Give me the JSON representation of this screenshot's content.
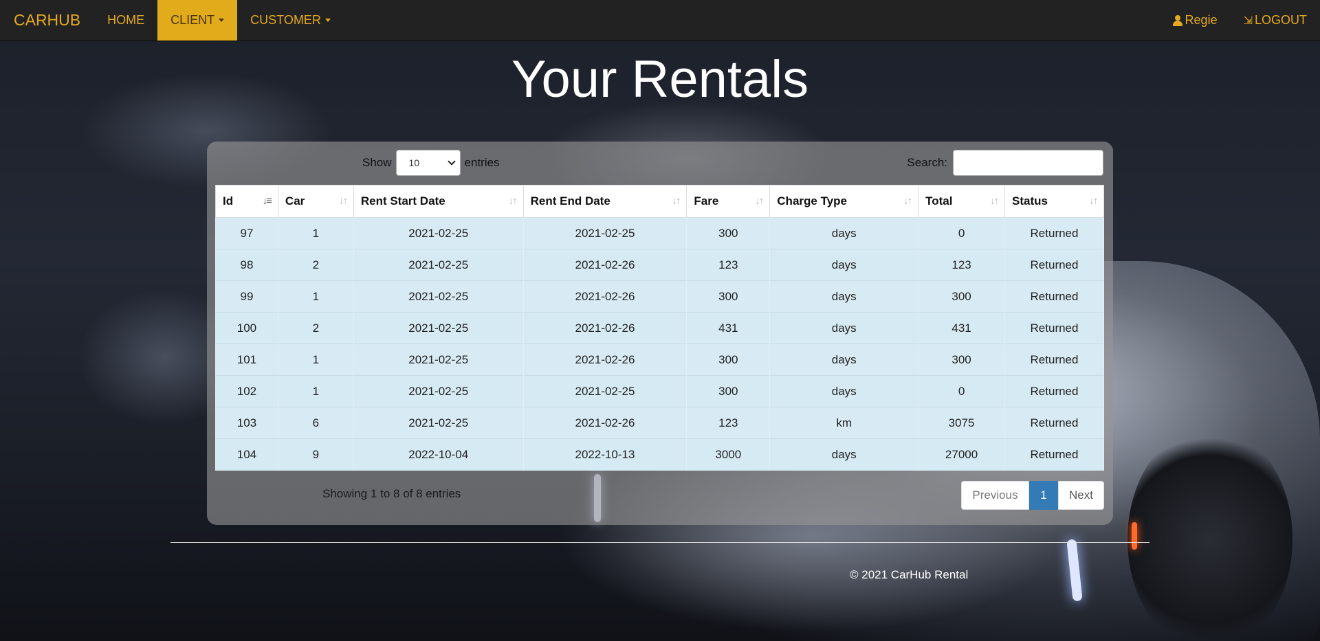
{
  "navbar": {
    "brand": "CARHUB",
    "items": [
      {
        "label": "HOME"
      },
      {
        "label": "CLIENT"
      },
      {
        "label": "CUSTOMER"
      }
    ],
    "user": "Regie",
    "logout": "LOGOUT"
  },
  "page_title": "Your Rentals",
  "table_controls": {
    "show_label": "Show",
    "entries_value": "10",
    "entries_label": "entries",
    "search_label": "Search:",
    "search_value": ""
  },
  "table": {
    "columns": [
      "Id",
      "Car",
      "Rent Start Date",
      "Rent End Date",
      "Fare",
      "Charge Type",
      "Total",
      "Status"
    ],
    "rows": [
      [
        "97",
        "1",
        "2021-02-25",
        "2021-02-25",
        "300",
        "days",
        "0",
        "Returned"
      ],
      [
        "98",
        "2",
        "2021-02-25",
        "2021-02-26",
        "123",
        "days",
        "123",
        "Returned"
      ],
      [
        "99",
        "1",
        "2021-02-25",
        "2021-02-26",
        "300",
        "days",
        "300",
        "Returned"
      ],
      [
        "100",
        "2",
        "2021-02-25",
        "2021-02-26",
        "431",
        "days",
        "431",
        "Returned"
      ],
      [
        "101",
        "1",
        "2021-02-25",
        "2021-02-26",
        "300",
        "days",
        "300",
        "Returned"
      ],
      [
        "102",
        "1",
        "2021-02-25",
        "2021-02-25",
        "300",
        "days",
        "0",
        "Returned"
      ],
      [
        "103",
        "6",
        "2021-02-25",
        "2021-02-26",
        "123",
        "km",
        "3075",
        "Returned"
      ],
      [
        "104",
        "9",
        "2022-10-04",
        "2022-10-13",
        "3000",
        "days",
        "27000",
        "Returned"
      ]
    ]
  },
  "info_text": "Showing 1 to 8 of 8 entries",
  "pagination": {
    "previous": "Previous",
    "current": "1",
    "next": "Next"
  },
  "footer": "© 2021 CarHub Rental",
  "colors": {
    "accent": "#e2ab1c",
    "navbar": "#222222",
    "pager_active": "#337ab7",
    "row_bg": "#d8ebf5"
  }
}
